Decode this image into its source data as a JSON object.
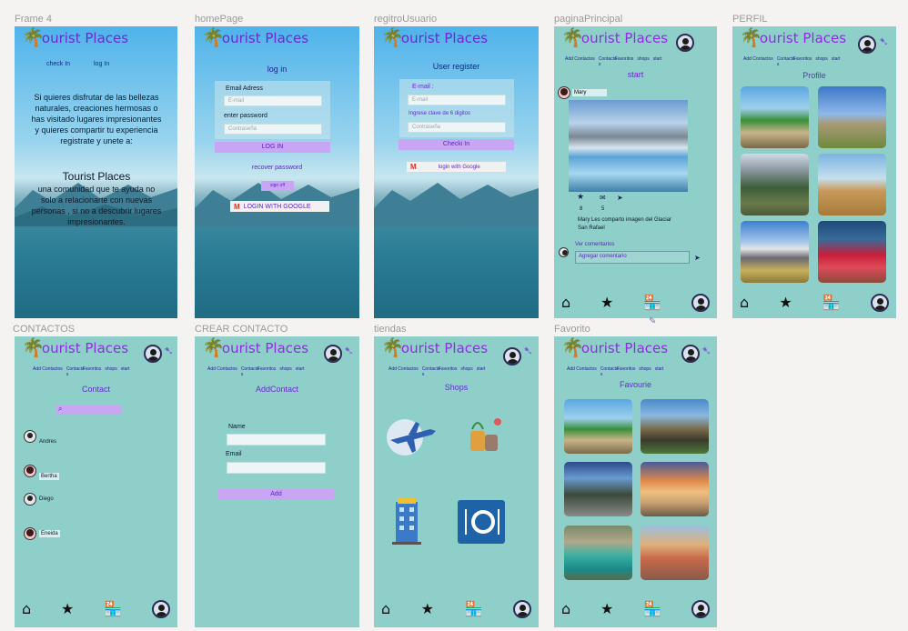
{
  "common": {
    "app_title": "ourist Places",
    "palm_glyph": "🌴",
    "menu": [
      "Add Contactos",
      "Contacto s",
      "Favoritos",
      "shops",
      "start"
    ],
    "nav": {
      "home": "⌂",
      "star": "★",
      "shop": "🏪"
    },
    "fav_arrow": "➷"
  },
  "labels": {
    "frame4": "Frame 4",
    "homePage": "homePage",
    "registro": "regitroUsuario",
    "principal": "paginaPrincipal",
    "perfil": "PERFIL",
    "contactos": "CONTACTOS",
    "crear": "CREAR CONTACTO",
    "tiendas": "tiendas",
    "favorito": "Favorito"
  },
  "frame4": {
    "check_in": "check In",
    "log_in": "log In",
    "body": "Si quieres disfrutar de las bellezas naturales, creaciones hermosas o has visitado lugares impresionantes y quieres compartir tu experiencia registrate y unete a:",
    "brand": "Tourist Places",
    "body2": "una comunidad que te ayuda no solo a relacionarte con nuevas personas , si no a descubrir lugares impresionantes."
  },
  "home": {
    "title": "log in",
    "email_label": "Email Adress",
    "email_placeholder": "E-mail",
    "password_label": "enter password",
    "password_placeholder": "Contraseña",
    "login_button": "LOG IN",
    "recover": "recover password",
    "signoff": "sign off",
    "google": "LOGIN WITH GOOGLE"
  },
  "register": {
    "title": "User register",
    "email_label": "E-mail :",
    "email_placeholder": "E-mail",
    "password_label": "Ingrese clave de 6 digitos",
    "password_placeholder": "Contraseña",
    "checkin_button": "Checki In",
    "google": "login with Google"
  },
  "principal": {
    "title": "start",
    "user": "Mary",
    "likes": "8",
    "messages": "5",
    "caption": "Mary Les comparto imagen del Glaciar San Rafael",
    "view_comments": "Ver comentarios",
    "comment_placeholder": "Agregar comentario",
    "icons": {
      "star": "★",
      "mail": "✉",
      "send": "➤"
    }
  },
  "perfil": {
    "title": "Profile"
  },
  "contactos": {
    "title": "Contact",
    "contacts": [
      "Andres",
      "Bertha",
      "Diego",
      "Eneida"
    ]
  },
  "crear": {
    "title": "AddContact",
    "name_label": "Name",
    "email_label": "Email",
    "add_button": "Add"
  },
  "tiendas": {
    "title": "Shops"
  },
  "favorito": {
    "title": "Favourie"
  },
  "colors": {
    "teal": "#8fcfca",
    "purple_text": "#8e2de2",
    "button_purple": "#c8a6f3",
    "navy_text": "#1e1e8a"
  }
}
